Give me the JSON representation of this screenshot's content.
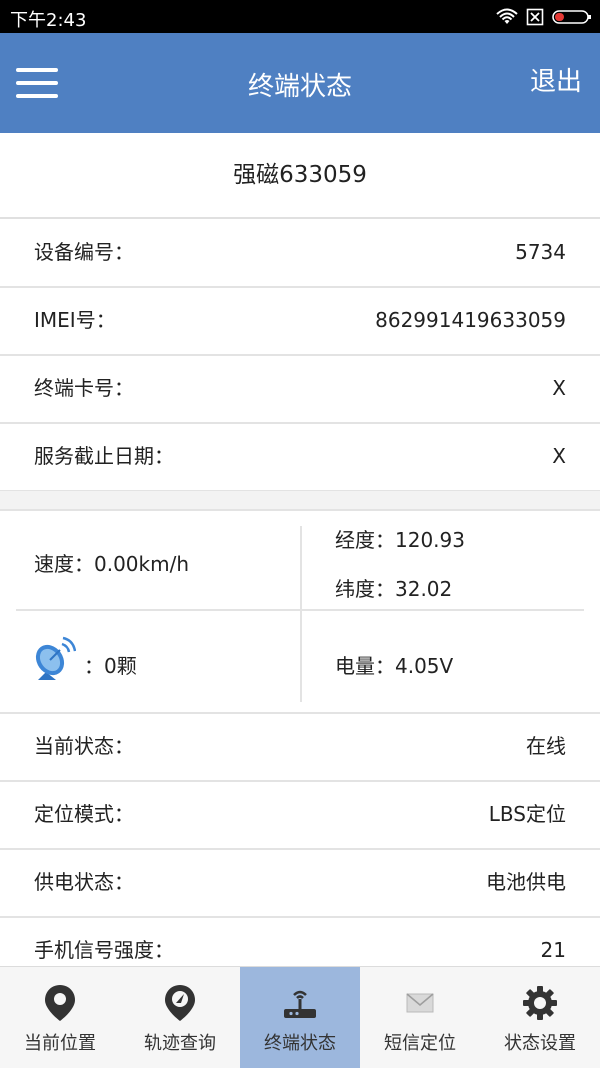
{
  "status_bar": {
    "time": "下午2:43"
  },
  "app_bar": {
    "title": "终端状态",
    "logout": "退出"
  },
  "device": {
    "name": "强磁633059"
  },
  "info_rows": [
    {
      "label": "设备编号：",
      "value": "5734"
    },
    {
      "label": "IMEI号：",
      "value": "862991419633059"
    },
    {
      "label": "终端卡号：",
      "value": "X"
    },
    {
      "label": "服务截止日期：",
      "value": "X"
    }
  ],
  "grid": {
    "speed": "速度：0.00km/h",
    "longitude": "经度：120.93",
    "latitude": "纬度：32.02",
    "satellites": "：0颗",
    "battery": "电量：4.05V"
  },
  "status_rows": [
    {
      "label": "当前状态：",
      "value": "在线"
    },
    {
      "label": "定位模式：",
      "value": "LBS定位"
    },
    {
      "label": "供电状态：",
      "value": "电池供电"
    },
    {
      "label": "手机信号强度：",
      "value": "21"
    }
  ],
  "bottom_nav": [
    {
      "label": "当前位置",
      "icon": "location-pin-icon"
    },
    {
      "label": "轨迹查询",
      "icon": "track-pin-icon"
    },
    {
      "label": "终端状态",
      "icon": "terminal-icon"
    },
    {
      "label": "短信定位",
      "icon": "envelope-icon"
    },
    {
      "label": "状态设置",
      "icon": "gear-icon"
    }
  ],
  "colors": {
    "primary": "#4f80c2",
    "active_tab": "#9cb7dd",
    "icon_dark": "#333333"
  }
}
